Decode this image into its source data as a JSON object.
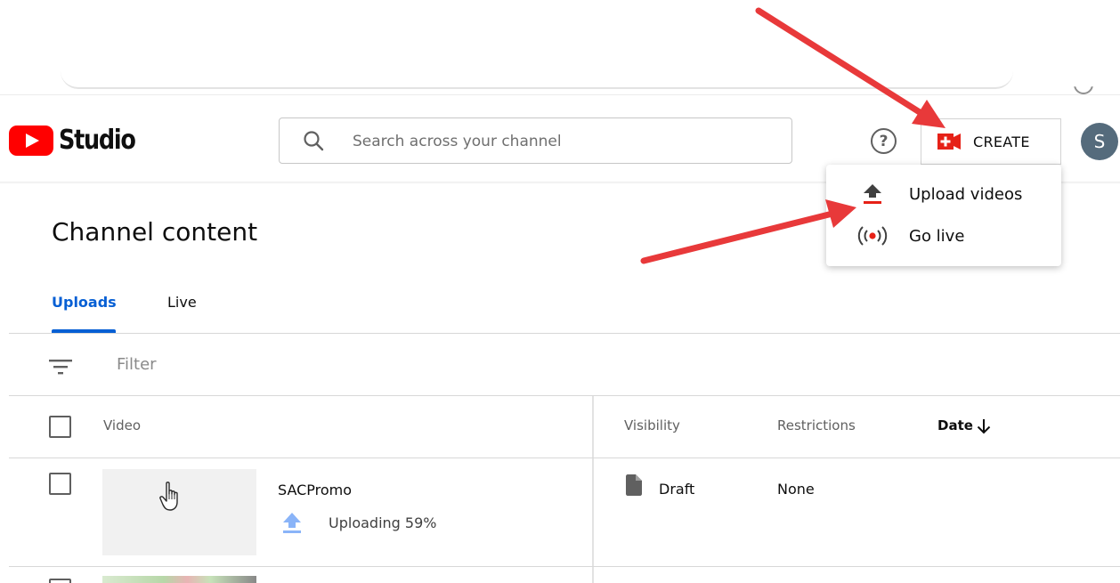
{
  "header": {
    "app_name": "Studio",
    "search_placeholder": "Search across your channel",
    "create_label": "CREATE",
    "avatar_initial": "S"
  },
  "create_menu": {
    "items": [
      {
        "label": "Upload videos",
        "icon": "upload-icon"
      },
      {
        "label": "Go live",
        "icon": "broadcast-icon"
      }
    ]
  },
  "page": {
    "title": "Channel content",
    "tabs": [
      {
        "label": "Uploads",
        "active": true
      },
      {
        "label": "Live",
        "active": false
      }
    ],
    "filter_placeholder": "Filter"
  },
  "table": {
    "columns": [
      "Video",
      "Visibility",
      "Restrictions",
      "Date"
    ],
    "sort_column": "Date",
    "rows": [
      {
        "title": "SACPromo",
        "status": "Uploading 59%",
        "upload_progress_percent": 59,
        "visibility": "Draft",
        "restrictions": "None",
        "date": ""
      }
    ]
  },
  "colors": {
    "brand_red": "#ff0000",
    "accent_blue": "#065fd4",
    "annotation_arrow": "#e8393a",
    "avatar_bg": "#556b7c"
  }
}
